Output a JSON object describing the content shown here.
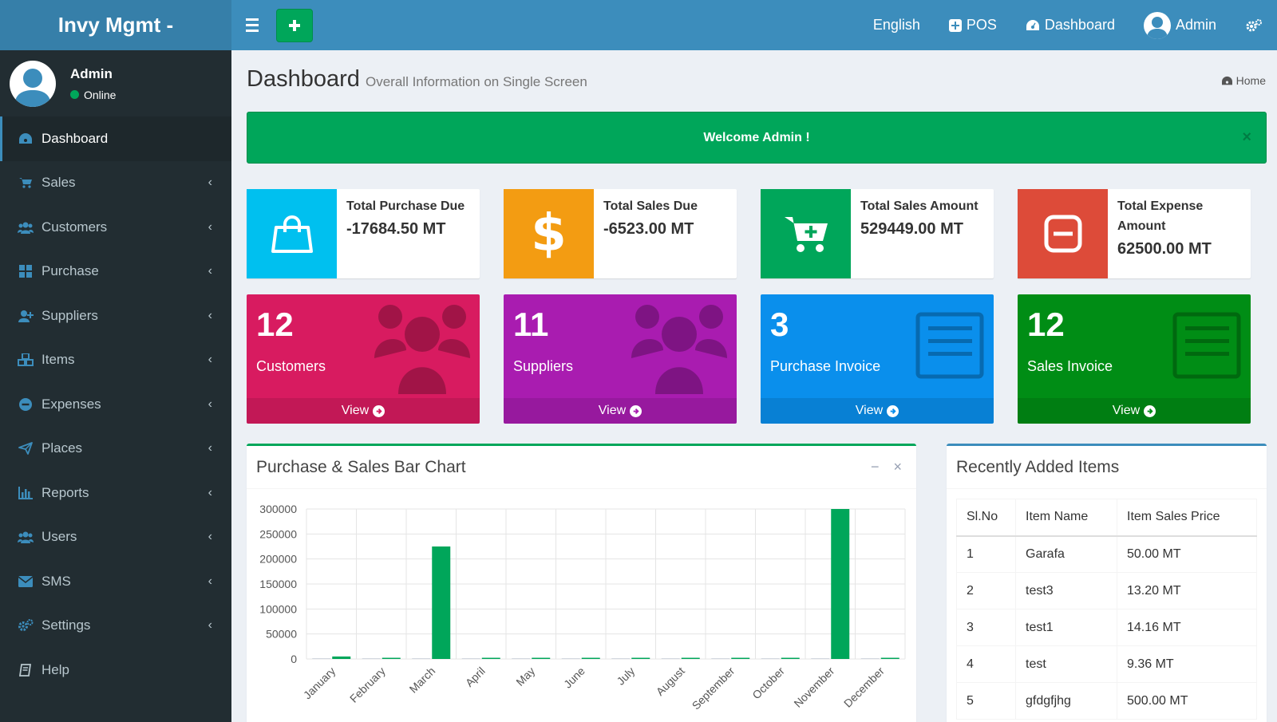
{
  "header": {
    "logo_text": "Invy Mgmt -",
    "language": "English",
    "pos_label": "POS",
    "dashboard_label": "Dashboard",
    "user_label": "Admin"
  },
  "sidebar": {
    "user_name": "Admin",
    "user_status": "Online",
    "items": [
      {
        "label": "Dashboard",
        "icon": "dashboard-icon",
        "active": true
      },
      {
        "label": "Sales",
        "icon": "cart-icon"
      },
      {
        "label": "Customers",
        "icon": "users-icon"
      },
      {
        "label": "Purchase",
        "icon": "grid-icon"
      },
      {
        "label": "Suppliers",
        "icon": "user-plus-icon"
      },
      {
        "label": "Items",
        "icon": "cubes-icon"
      },
      {
        "label": "Expenses",
        "icon": "minus-circle-icon"
      },
      {
        "label": "Places",
        "icon": "paper-plane-icon"
      },
      {
        "label": "Reports",
        "icon": "bar-chart-icon"
      },
      {
        "label": "Users",
        "icon": "users-icon"
      },
      {
        "label": "SMS",
        "icon": "envelope-icon"
      },
      {
        "label": "Settings",
        "icon": "cogs-icon"
      },
      {
        "label": "Help",
        "icon": "book-icon"
      }
    ]
  },
  "page": {
    "title": "Dashboard",
    "subtitle": "Overall Information on Single Screen",
    "breadcrumb": "Home"
  },
  "alert": {
    "text": "Welcome Admin !",
    "close": "×"
  },
  "info_boxes": [
    {
      "label": "Total Purchase Due",
      "value": "-17684.50 MT",
      "color": "#00c0ef",
      "icon": "shopping-bag-icon"
    },
    {
      "label": "Total Sales Due",
      "value": "-6523.00 MT",
      "color": "#f39c12",
      "icon": "dollar-icon"
    },
    {
      "label": "Total Sales Amount",
      "value": "529449.00 MT",
      "color": "#00a65a",
      "icon": "cart-plus-icon"
    },
    {
      "label": "Total Expense Amount",
      "value": "62500.00 MT",
      "color": "#dd4b39",
      "icon": "minus-square-icon"
    }
  ],
  "small_boxes": [
    {
      "count": "12",
      "label": "Customers",
      "footer": "View",
      "color": "#d81b60",
      "icon": "group-icon"
    },
    {
      "count": "11",
      "label": "Suppliers",
      "footer": "View",
      "color": "#a91cb0",
      "icon": "group-icon"
    },
    {
      "count": "3",
      "label": "Purchase Invoice",
      "footer": "View",
      "color": "#0a8fec",
      "icon": "invoice-icon"
    },
    {
      "count": "12",
      "label": "Sales Invoice",
      "footer": "View",
      "color": "#008d15",
      "icon": "invoice-icon"
    }
  ],
  "chart_box": {
    "title": "Purchase & Sales Bar Chart",
    "minimize": "−",
    "close": "×"
  },
  "chart_data": {
    "type": "bar",
    "categories": [
      "January",
      "February",
      "March",
      "April",
      "May",
      "June",
      "July",
      "August",
      "September",
      "October",
      "November",
      "December"
    ],
    "series": [
      {
        "values": [
          0,
          0,
          0,
          0,
          0,
          0,
          0,
          0,
          0,
          0,
          0,
          0
        ],
        "color": "#d2d6de"
      },
      {
        "values": [
          5000,
          1500,
          225000,
          1500,
          1500,
          1500,
          1500,
          1500,
          1500,
          1500,
          300000,
          1500
        ],
        "color": "#00a65a"
      }
    ],
    "yticks": [
      0,
      50000,
      100000,
      150000,
      200000,
      250000,
      300000
    ],
    "ylim": [
      0,
      300000
    ],
    "grid": true
  },
  "items_box": {
    "title": "Recently Added Items",
    "columns": [
      "Sl.No",
      "Item Name",
      "Item Sales Price"
    ],
    "rows": [
      [
        "1",
        "Garafa",
        "50.00 MT"
      ],
      [
        "2",
        "test3",
        "13.20 MT"
      ],
      [
        "3",
        "test1",
        "14.16 MT"
      ],
      [
        "4",
        "test",
        "9.36 MT"
      ],
      [
        "5",
        "gfdgfjhg",
        "500.00 MT"
      ]
    ]
  }
}
